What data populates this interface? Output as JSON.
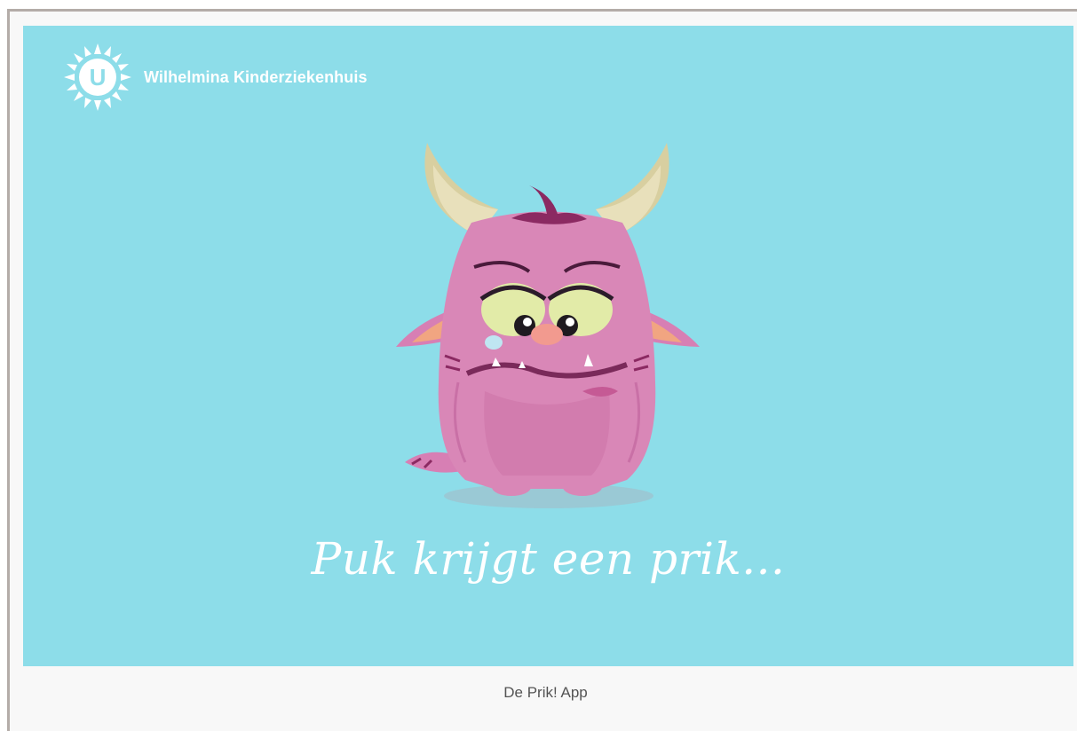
{
  "banner": {
    "logo_text": "Wilhelmina Kinderziekenhuis",
    "logo_letter": "U",
    "title": "Puk krijgt een prik...",
    "background_color": "#8ddde9",
    "character": "pink-monster-puk"
  },
  "caption": {
    "text": "De Prik! App"
  }
}
